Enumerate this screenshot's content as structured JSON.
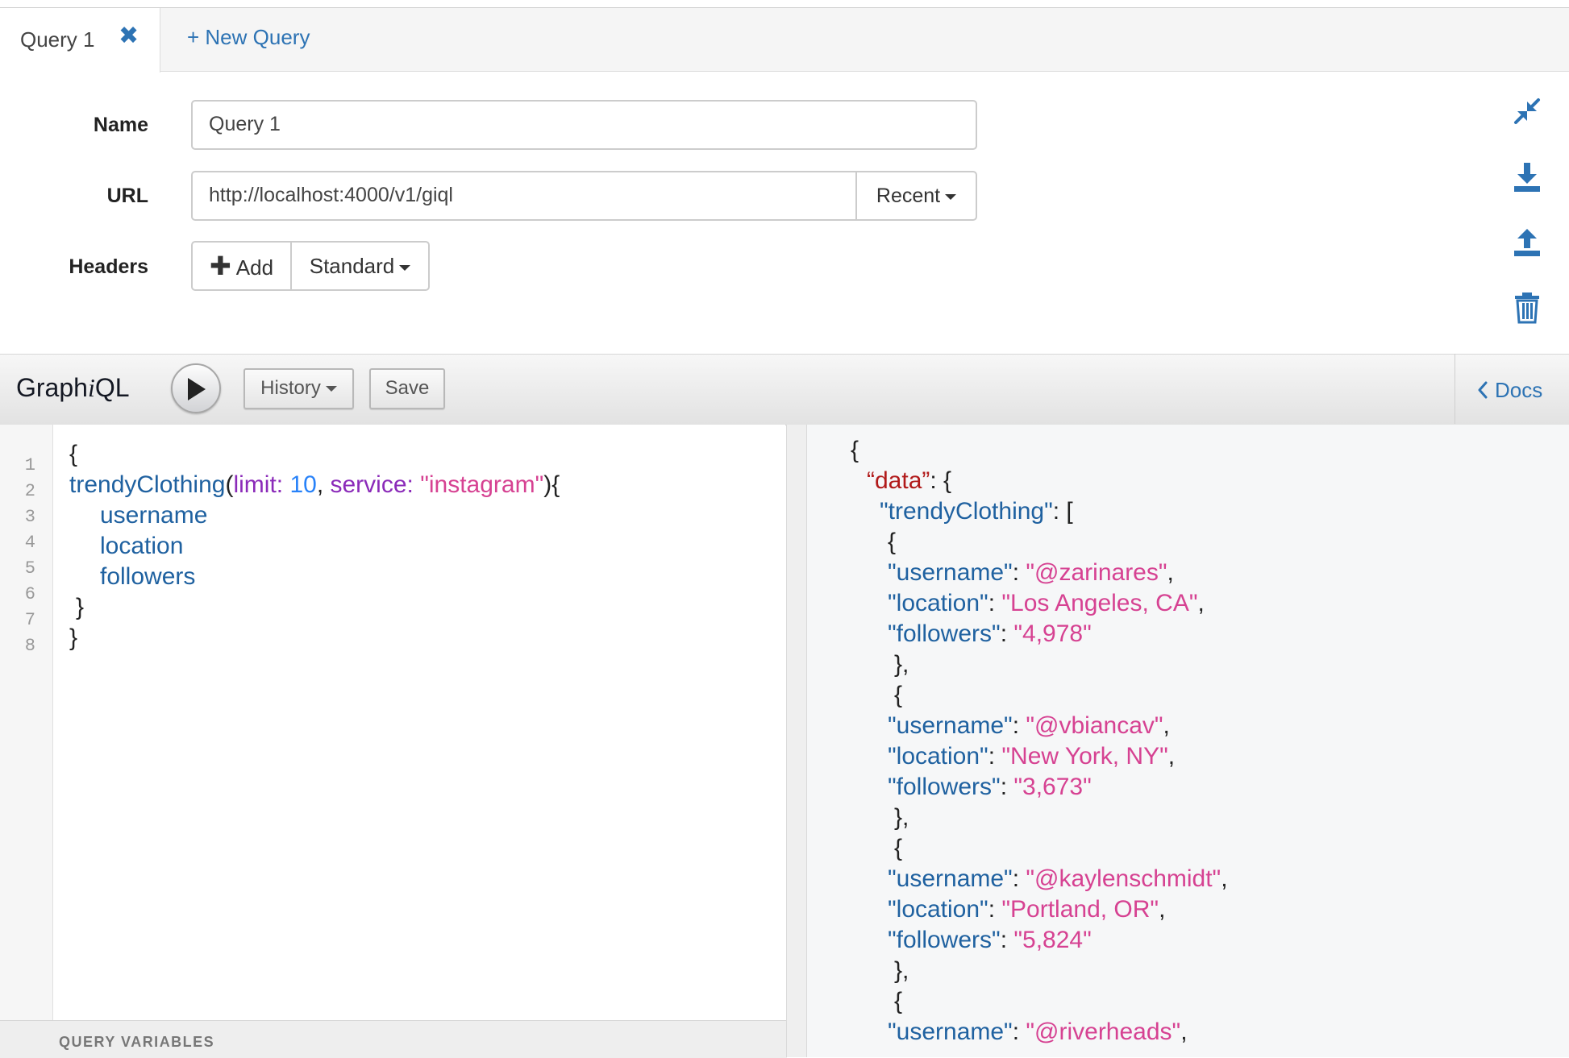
{
  "tabs": {
    "active_label": "Query 1",
    "close_icon": "close-icon",
    "new_query_label": "+ New Query"
  },
  "form": {
    "name_label": "Name",
    "name_value": "Query 1",
    "url_label": "URL",
    "url_value": "http://localhost:4000/v1/giql",
    "recent_label": "Recent",
    "headers_label": "Headers",
    "add_label": "Add",
    "standard_label": "Standard"
  },
  "side_actions": [
    "compress-icon",
    "download-icon",
    "upload-icon",
    "trash-icon"
  ],
  "toolbar": {
    "title_prefix": "Graph",
    "title_italic": "i",
    "title_suffix": "QL",
    "history_label": "History",
    "save_label": "Save",
    "docs_label": "Docs"
  },
  "editor": {
    "line_numbers": [
      "1",
      "2",
      "3",
      "4",
      "5",
      "6",
      "7",
      "8"
    ],
    "line1": "{",
    "query_name": "trendyClothing",
    "paren_open": "(",
    "arg1_name": "limit:",
    "arg1_value": "10",
    "comma": ", ",
    "arg2_name": "service:",
    "arg2_value": "\"instagram\"",
    "paren_close": "){",
    "fields": [
      "username",
      "location",
      "followers"
    ],
    "inner_close": "}",
    "outer_close": "}",
    "variables_label": "QUERY VARIABLES"
  },
  "result": {
    "open_brace": "{",
    "data_key": "“data”",
    "data_colon": ": {",
    "list_key": "\"trendyClothing\"",
    "list_colon": ": [",
    "items": [
      {
        "username": "\"@zarinares\"",
        "location": "\"Los Angeles, CA\"",
        "followers": "\"4,978\""
      },
      {
        "username": "\"@vbiancav\"",
        "location": "\"New York, NY\"",
        "followers": "\"3,673\""
      },
      {
        "username": "\"@kaylenschmidt\"",
        "location": "\"Portland, OR\"",
        "followers": "\"5,824\""
      },
      {
        "username": "\"@riverheads\""
      }
    ],
    "username_key": "\"username\"",
    "location_key": "\"location\"",
    "followers_key": "\"followers\"",
    "obj_open": "{",
    "obj_close": "},"
  }
}
